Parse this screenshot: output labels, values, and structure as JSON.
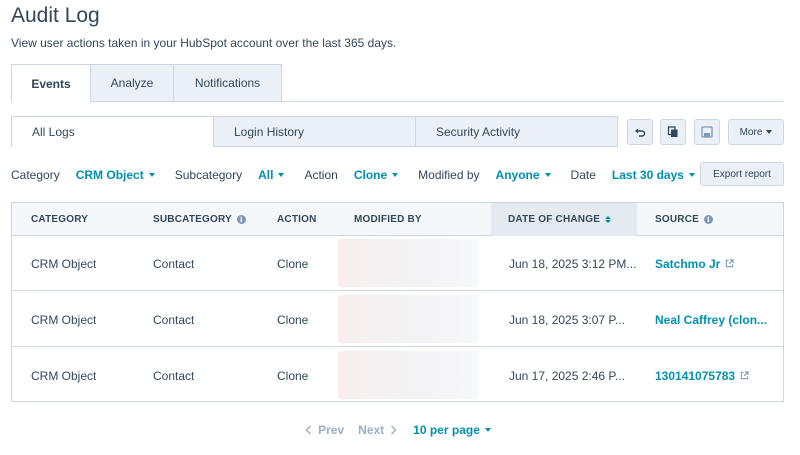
{
  "page": {
    "title": "Audit Log",
    "subtitle": "View user actions taken in your HubSpot account over the last 365 days."
  },
  "main_tabs": [
    {
      "label": "Events",
      "active": true
    },
    {
      "label": "Analyze",
      "active": false
    },
    {
      "label": "Notifications",
      "active": false
    }
  ],
  "sub_tabs": [
    {
      "label": "All Logs",
      "active": true
    },
    {
      "label": "Login History",
      "active": false
    },
    {
      "label": "Security Activity",
      "active": false
    }
  ],
  "toolbar": {
    "icons": [
      "undo-icon",
      "copy-icon",
      "save-icon"
    ],
    "more_label": "More"
  },
  "filters": [
    {
      "label": "Category",
      "value": "CRM Object"
    },
    {
      "label": "Subcategory",
      "value": "All"
    },
    {
      "label": "Action",
      "value": "Clone"
    },
    {
      "label": "Modified by",
      "value": "Anyone"
    },
    {
      "label": "Date",
      "value": "Last 30 days"
    }
  ],
  "export_label": "Export report",
  "table": {
    "headers": {
      "category": "CATEGORY",
      "subcategory": "SUBCATEGORY",
      "action": "ACTION",
      "modified_by": "MODIFIED BY",
      "date": "DATE OF CHANGE",
      "source": "SOURCE"
    },
    "rows": [
      {
        "category": "CRM Object",
        "subcategory": "Contact",
        "action": "Clone",
        "date": "Jun 18, 2025 3:12 PM...",
        "source": "Satchmo Jr",
        "source_external": true
      },
      {
        "category": "CRM Object",
        "subcategory": "Contact",
        "action": "Clone",
        "date": "Jun 18, 2025 3:07 P...",
        "source": "Neal Caffrey (clon...",
        "source_external": false
      },
      {
        "category": "CRM Object",
        "subcategory": "Contact",
        "action": "Clone",
        "date": "Jun 17, 2025 2:46 P...",
        "source": "130141075783",
        "source_external": true
      }
    ]
  },
  "pagination": {
    "prev": "Prev",
    "next": "Next",
    "per_page": "10 per page"
  },
  "colors": {
    "text": "#33475b",
    "link": "#0091ae",
    "border": "#cbd6e2",
    "inactive_bg": "#eaf0f6",
    "header_bg": "#f5f8fa"
  }
}
